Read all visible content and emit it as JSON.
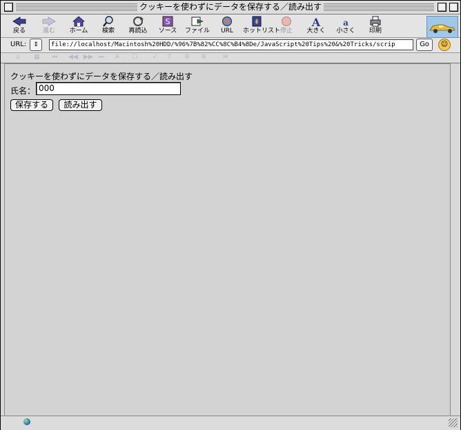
{
  "window": {
    "title": "クッキーを使わずにデータを保存する／読み出す"
  },
  "toolbar": {
    "buttons": [
      {
        "label": "戻る",
        "icon": "back-arrow-icon",
        "enabled": true
      },
      {
        "label": "進む",
        "icon": "forward-arrow-icon",
        "enabled": false
      },
      {
        "label": "ホーム",
        "icon": "home-icon",
        "enabled": true
      },
      {
        "label": "検索",
        "icon": "search-icon",
        "enabled": true
      },
      {
        "label": "再読込",
        "icon": "reload-icon",
        "enabled": true
      },
      {
        "label": "ソース",
        "icon": "source-icon",
        "enabled": true
      },
      {
        "label": "ファイル",
        "icon": "file-icon",
        "enabled": true
      },
      {
        "label": "URL",
        "icon": "url-globe-icon",
        "enabled": true
      },
      {
        "label": "ホットリスト",
        "icon": "hotlist-icon",
        "enabled": true
      },
      {
        "label": "停止",
        "icon": "stop-icon",
        "enabled": false
      },
      {
        "label": "大きく",
        "icon": "text-larger-icon",
        "enabled": true
      },
      {
        "label": "小さく",
        "icon": "text-smaller-icon",
        "enabled": true
      },
      {
        "label": "印刷",
        "icon": "print-icon",
        "enabled": true
      }
    ]
  },
  "urlbar": {
    "label": "URL:",
    "value": "file://localhost/Macintosh%20HDD/%96%7B%82%CC%8C%B4%8De/JavaScript%20Tips%20&%20Tricks/scrip",
    "go_label": "Go"
  },
  "page": {
    "heading": "クッキーを使わずにデータを保存する／読み出す",
    "name_label": "氏名：",
    "name_value": "000",
    "save_label": "保存する",
    "load_label": "読み出す"
  },
  "colors": {
    "accent_blue": "#2a4a9a",
    "brand_bg": "#9dc8ea",
    "car": "#e7b93a"
  }
}
